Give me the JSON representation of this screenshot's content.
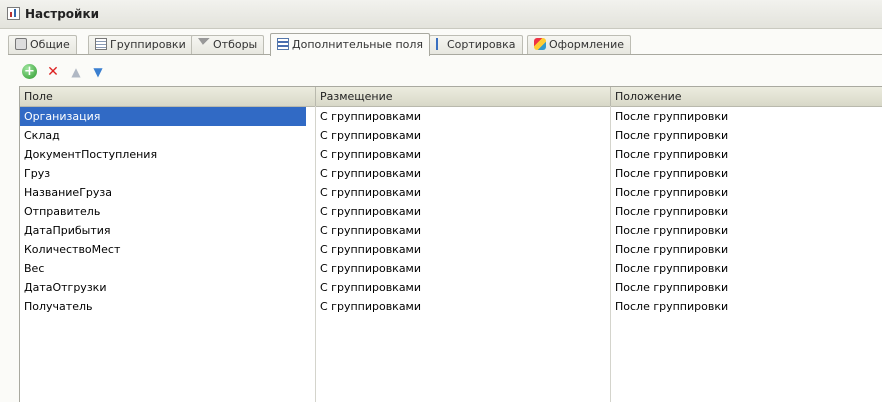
{
  "window": {
    "title": "Настройки"
  },
  "tabs": [
    {
      "label": "Общие",
      "icon": "wrench-icon",
      "active": false
    },
    {
      "label": "Группировки",
      "icon": "grouping-icon",
      "active": false
    },
    {
      "label": "Отборы",
      "icon": "filter-icon",
      "active": false
    },
    {
      "label": "Дополнительные поля",
      "icon": "fields-list-icon",
      "active": true
    },
    {
      "label": "Сортировка",
      "icon": "sort-icon",
      "active": false
    },
    {
      "label": "Оформление",
      "icon": "paint-icon",
      "active": false
    }
  ],
  "toolbar": {
    "add": "add-icon",
    "delete": "delete-icon",
    "up": "arrow-up-icon",
    "down": "arrow-down-icon"
  },
  "table": {
    "columns": [
      "Поле",
      "Размещение",
      "Положение"
    ],
    "rows": [
      [
        "Организация",
        "С группировками",
        "После группировки"
      ],
      [
        "Склад",
        "С группировками",
        "После группировки"
      ],
      [
        "ДокументПоступления",
        "С группировками",
        "После группировки"
      ],
      [
        "Груз",
        "С группировками",
        "После группировки"
      ],
      [
        "НазваниеГруза",
        "С группировками",
        "После группировки"
      ],
      [
        "Отправитель",
        "С группировками",
        "После группировки"
      ],
      [
        "ДатаПрибытия",
        "С группировками",
        "После группировки"
      ],
      [
        "КоличествоМест",
        "С группировками",
        "После группировки"
      ],
      [
        "Вес",
        "С группировками",
        "После группировки"
      ],
      [
        "ДатаОтгрузки",
        "С группировками",
        "После группировки"
      ],
      [
        "Получатель",
        "С группировками",
        "После группировки"
      ]
    ],
    "selected_row": 0
  },
  "colors": {
    "selection": "#316ac5",
    "header": "#d8d8c8"
  }
}
